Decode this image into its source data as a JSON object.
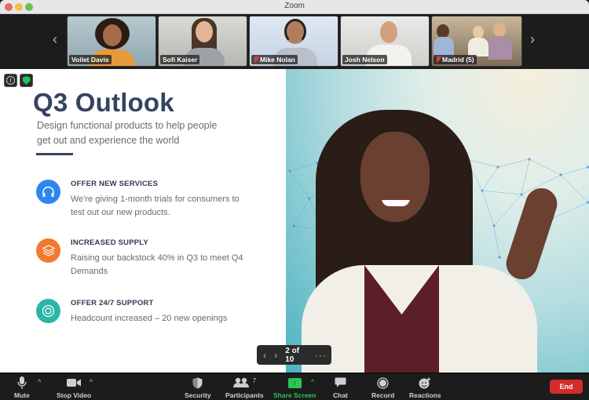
{
  "window": {
    "title": "Zoom"
  },
  "gallery": {
    "participants": [
      {
        "name": "Voilet Davis",
        "muted": false
      },
      {
        "name": "Sofi Kaiser",
        "muted": false
      },
      {
        "name": "Mike Nolan",
        "muted": true
      },
      {
        "name": "Josh Nelson",
        "muted": false
      },
      {
        "name": "Madrid (5)",
        "muted": true
      }
    ]
  },
  "slide": {
    "title": "Q3 Outlook",
    "subtitle": "Design functional products to help people get out and experience the world",
    "features": [
      {
        "heading": "OFFER NEW SERVICES",
        "body": "We're giving 1-month trials for consumers to test out our new products.",
        "icon": "headphones-icon",
        "color": "#2f86f2"
      },
      {
        "heading": "INCREASED SUPPLY",
        "body": "Raising our backstock 40% in Q3 to meet Q4 Demands",
        "icon": "layers-icon",
        "color": "#f07a2f"
      },
      {
        "heading": "OFFER 24/7 SUPPORT",
        "body": "Headcount increased – 20 new openings",
        "icon": "lifebuoy-icon",
        "color": "#2bb5a6"
      }
    ],
    "pager": {
      "current": 2,
      "total": 10,
      "label": "2 of 10"
    }
  },
  "toolbar": {
    "mute": "Mute",
    "stop_video": "Stop Video",
    "security": "Security",
    "participants": "Participants",
    "participant_count": "7",
    "share_screen": "Share Screen",
    "chat": "Chat",
    "record": "Record",
    "reactions": "Reactions",
    "end": "End"
  },
  "colors": {
    "share_green": "#28c654",
    "end_red": "#d42b2b",
    "title_navy": "#344360"
  }
}
